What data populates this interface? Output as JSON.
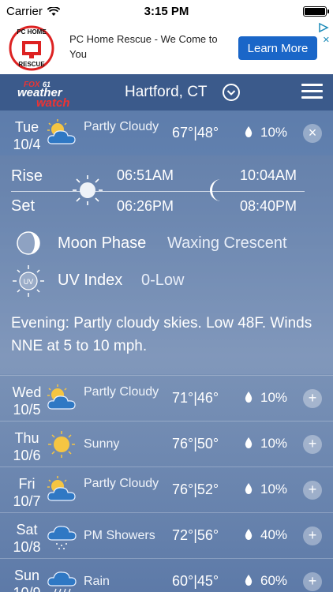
{
  "status_bar": {
    "carrier": "Carrier",
    "time": "3:15 PM"
  },
  "ad": {
    "logo_text_top": "PC HOME",
    "logo_text_bottom": "RESCUE",
    "text": "PC Home Rescue - We Come to You",
    "button": "Learn More"
  },
  "header": {
    "brand_line1": "FOX 61",
    "brand_line2": "weather",
    "brand_line3": "watch",
    "location": "Hartford, CT"
  },
  "today": {
    "day": "Tue",
    "date": "10/4",
    "condition": "Partly Cloudy",
    "temps": "67°|48°",
    "precip": "10%",
    "action": "×"
  },
  "details": {
    "rise_label": "Rise",
    "set_label": "Set",
    "sunrise": "06:51AM",
    "sunset": "06:26PM",
    "moonrise": "10:04AM",
    "moonset": "08:40PM",
    "moon_phase_label": "Moon Phase",
    "moon_phase_value": "Waxing Crescent",
    "uv_label": "UV Index",
    "uv_value": "0-Low",
    "uv_icon_text": "UV",
    "description": "Evening: Partly cloudy skies. Low 48F. Winds NNE at 5 to 10 mph."
  },
  "forecast": [
    {
      "day": "Wed",
      "date": "10/5",
      "condition": "Partly Cloudy",
      "temps": "71°|46°",
      "precip": "10%",
      "action": "+",
      "icon": "partly-cloudy-icon"
    },
    {
      "day": "Thu",
      "date": "10/6",
      "condition": "Sunny",
      "temps": "76°|50°",
      "precip": "10%",
      "action": "+",
      "icon": "sunny-icon"
    },
    {
      "day": "Fri",
      "date": "10/7",
      "condition": "Partly Cloudy",
      "temps": "76°|52°",
      "precip": "10%",
      "action": "+",
      "icon": "partly-cloudy-icon"
    },
    {
      "day": "Sat",
      "date": "10/8",
      "condition": "PM Showers",
      "temps": "72°|56°",
      "precip": "40%",
      "action": "+",
      "icon": "showers-icon"
    },
    {
      "day": "Sun",
      "date": "10/9",
      "condition": "Rain",
      "temps": "60°|45°",
      "precip": "60%",
      "action": "+",
      "icon": "rain-icon"
    }
  ],
  "colors": {
    "accent": "#1a66c8",
    "header_bg": "#3b5a8b",
    "sun": "#f5c542"
  }
}
